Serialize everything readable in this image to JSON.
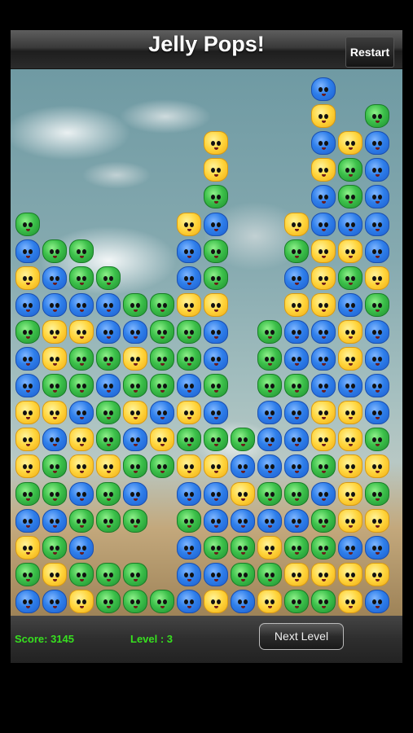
{
  "header": {
    "title": "Jelly Pops!",
    "restart_label": "Restart"
  },
  "footer": {
    "score_label": "Score: 3145",
    "level_label": "Level : 3",
    "next_level_label": "Next Level"
  },
  "board": {
    "columns": 14,
    "rows": 20,
    "colors": {
      "B": "#2f7fea",
      "G": "#3cc04a",
      "Y": "#ffd43a"
    },
    "grid": [
      "...........B..",
      "...........Y.G",
      ".......Y...BYB",
      ".......Y...YGB",
      ".......G...BGB",
      "G.....YB..YBBB",
      "BGG...BG..GYYB",
      "YBGG..BG..BYGY",
      "BBBBGGYY..YYBG",
      "GYYBBGGB.GBBYB",
      "BYGGYGGB.GBBYB",
      "BGGBGGBG.GGBBB",
      "YYBGYBYB.BBYYB",
      "YBYGBYGGGBBYYG",
      "YGYYGGYYBBBGYY",
      "GGBGB.BBYGGBYG",
      "BBGGG.GBBBBGYY",
      "YGB...BGGYGGBB",
      "GYGGG.BBGGYYYY",
      "BBYGGGBYBYGGYB"
    ]
  }
}
